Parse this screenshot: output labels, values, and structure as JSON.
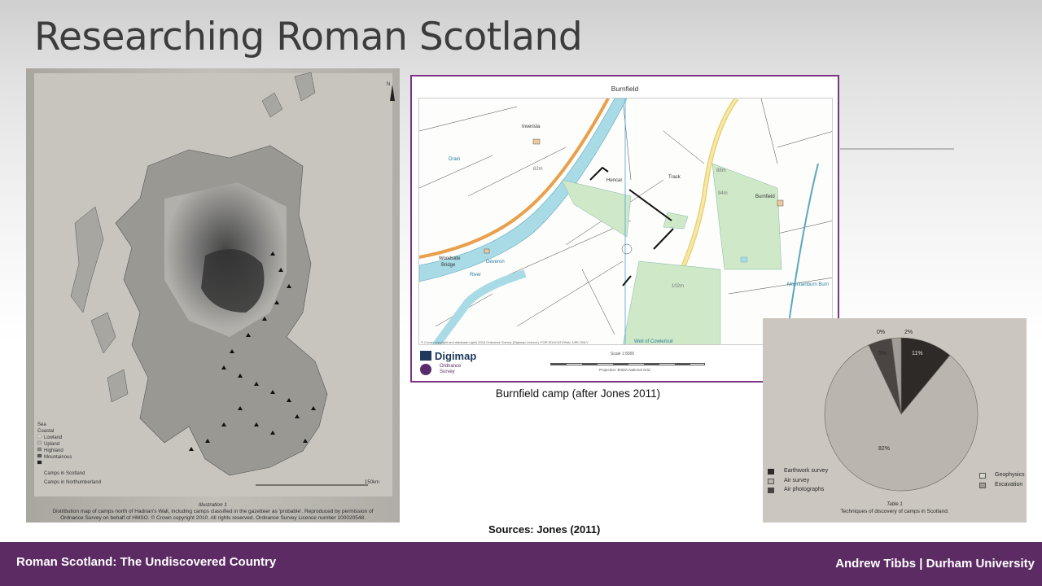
{
  "slide": {
    "title": "Researching Roman Scotland",
    "sources": "Sources: Jones (2011)"
  },
  "footer": {
    "left": "Roman Scotland: The Undiscovered Country",
    "right": "Andrew Tibbs | Durham University"
  },
  "illustration": {
    "label": "Illustration 1",
    "caption_line1": "Distribution map of camps north of Hadrian's Wall, including camps classified in the gazetteer as 'probable'. Reproduced by permission of",
    "caption_line2": "Ordnance Survey on behalf of HMSO. © Crown copyright 2010. All rights reserved. Ordnance Survey Licence number 100020548.",
    "legend": [
      "Sea",
      "Coastal",
      "Lowland",
      "Upland",
      "Highland",
      "Mountainous"
    ],
    "symbols": [
      "Camps in Scotland",
      "Camps in Northumberland"
    ],
    "north": "N",
    "scale_end": "150km"
  },
  "map": {
    "title": "Burnfield",
    "caption": "Burnfield camp (after Jones 2011)",
    "labels": {
      "inverisla": "Inverisla",
      "hencar": "Hencar",
      "burnfield": "Burnfield",
      "woodside": "Woodside",
      "bridge": "Bridge",
      "river": "River",
      "deveron": "Deveron",
      "drain": "Drain",
      "track": "Track",
      "well": "Well of Cowiemuir",
      "burn": "Mountainburn Burn",
      "h82": "82m",
      "h88": "88m",
      "h94": "94m",
      "h102": "102m"
    },
    "digimap": "Digimap",
    "os_line1": "Ordnance",
    "os_line2": "Survey",
    "scale": "Scale 1:5000",
    "projection": "Projection: British National Grid",
    "copyright": "© Crown copyright and database rights 2018 Ordnance Survey (Digimap Licence). FOR EDUCATIONAL USE ONLY"
  },
  "chart_data": {
    "type": "pie",
    "title": "",
    "slices": [
      {
        "label": "Earthwork survey",
        "value": 11,
        "display": "11%",
        "color": "#2e2a27"
      },
      {
        "label": "Air survey",
        "value": 82,
        "display": "82%",
        "color": "#bab5ae"
      },
      {
        "label": "Air photographs",
        "value": 5,
        "display": "5%",
        "color": "#4a4542"
      },
      {
        "label": "Geophysics",
        "value": 0,
        "display": "0%",
        "color": "#d9d5cf"
      },
      {
        "label": "Excavation",
        "value": 2,
        "display": "2%",
        "color": "#a19c95"
      }
    ],
    "legend_left": [
      "Earthwork survey",
      "Air survey",
      "Air photographs"
    ],
    "legend_right": [
      "Geophysics",
      "Excavation"
    ],
    "table_label": "Table 1",
    "caption": "Techniques of discovery of camps in Scotland."
  }
}
